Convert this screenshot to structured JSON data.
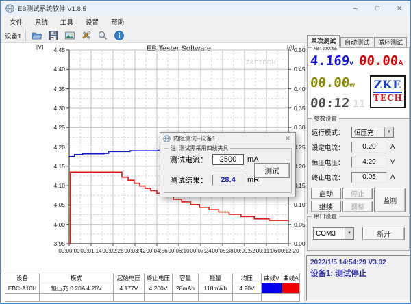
{
  "window": {
    "title": "EB测试系统软件 V1.8.5",
    "minimize": "─",
    "maximize": "□",
    "close": "✕"
  },
  "menu": {
    "items": [
      "文件",
      "系统",
      "工具",
      "设置",
      "帮助"
    ]
  },
  "toolbar": {
    "device_label": "设备1"
  },
  "chart_data": {
    "type": "line",
    "title": "EB Tester Software",
    "watermark": "ZKETECH",
    "y_left": {
      "label": "[V]",
      "range": [
        3.95,
        4.45
      ],
      "tick_labels": [
        "4.45",
        "4.40",
        "4.35",
        "4.30",
        "4.25",
        "4.20",
        "4.15",
        "4.10",
        "4.05",
        "4.00",
        "3.95"
      ]
    },
    "y_right": {
      "label": "[A]",
      "range": [
        0.0,
        0.5
      ],
      "tick_labels": [
        "0.50",
        "0.45",
        "0.40",
        "0.35",
        "0.30",
        "0.25",
        "0.20",
        "0.15",
        "0.10",
        "0.05",
        "0.00"
      ]
    },
    "x_axis": {
      "ticks_s": [
        0,
        74,
        148,
        222,
        296,
        370,
        444,
        518,
        592,
        666,
        740
      ],
      "tick_labels": [
        "00:00:00",
        "00:01:14",
        "00:02:28",
        "00:03:42",
        "00:04:56",
        "00:06:10",
        "00:07:24",
        "00:08:38",
        "00:09:52",
        "00:11:06",
        "00:12:20"
      ]
    },
    "series": [
      {
        "name": "voltage",
        "legend": "曲线V",
        "axis": "left",
        "color": "#1717cf",
        "step": true,
        "points": [
          [
            0,
            4.175
          ],
          [
            18,
            4.18
          ],
          [
            45,
            4.182
          ],
          [
            118,
            4.183
          ],
          [
            133,
            4.188
          ],
          [
            205,
            4.19
          ],
          [
            300,
            4.191
          ],
          [
            370,
            4.193
          ],
          [
            440,
            4.195
          ],
          [
            505,
            4.198
          ],
          [
            520,
            4.2
          ],
          [
            740,
            4.2
          ]
        ]
      },
      {
        "name": "current",
        "legend": "曲线A",
        "axis": "right",
        "color": "#e51717",
        "step": true,
        "points": [
          [
            0,
            0.0
          ],
          [
            4,
            0.185
          ],
          [
            173,
            0.185
          ],
          [
            178,
            0.172
          ],
          [
            199,
            0.164
          ],
          [
            219,
            0.156
          ],
          [
            238,
            0.149
          ],
          [
            256,
            0.143
          ],
          [
            275,
            0.137
          ],
          [
            296,
            0.13
          ],
          [
            324,
            0.122
          ],
          [
            352,
            0.115
          ],
          [
            380,
            0.108
          ],
          [
            410,
            0.101
          ],
          [
            440,
            0.094
          ],
          [
            472,
            0.088
          ],
          [
            505,
            0.082
          ],
          [
            540,
            0.076
          ],
          [
            580,
            0.07
          ],
          [
            625,
            0.064
          ],
          [
            675,
            0.06
          ],
          [
            740,
            0.057
          ]
        ]
      }
    ]
  },
  "table": {
    "headers": [
      "设备",
      "模式",
      "起始电压",
      "终止电压",
      "容量",
      "能量",
      "均压",
      "曲线V",
      "曲线A"
    ],
    "row": [
      "EBC-A10H",
      "恒压充  0.20A  4.20V",
      "4.177V",
      "4.200V",
      "28mAh",
      "118mWh",
      "4.20V"
    ],
    "curve_v_color": "#0000ee",
    "curve_a_color": "#f00000"
  },
  "right_panel": {
    "tabs": [
      "单次测试",
      "自动测试",
      "循环测试"
    ],
    "run_data": {
      "group_label": "运行数据",
      "voltage": "4.169",
      "voltage_unit": "v",
      "current": "00.00",
      "current_unit": "A",
      "power": "00.00",
      "power_unit": "w",
      "time": "00:12",
      "time_dim": "11",
      "logo_line1": "ZKE",
      "logo_line2": "TECH"
    },
    "params": {
      "group_label": "参数设置",
      "mode_label": "运行模式：",
      "mode_value": "恒压充",
      "set_current_label": "设定电流：",
      "set_current_value": "0.20",
      "set_current_unit": "A",
      "cv_label": "恒压电压：",
      "cv_value": "4.20",
      "cv_unit": "V",
      "end_current_label": "终止电流：",
      "end_current_value": "0.05",
      "end_current_unit": "A",
      "start": "启动",
      "stop": "停止",
      "monitor": "监测",
      "resume": "继续",
      "adjust": "调整"
    },
    "serial": {
      "group_label": "串口设置",
      "port": "COM3",
      "disconnect": "断开"
    },
    "status": {
      "line1": "2022/1/5 14:54:29  V3.02",
      "line2": "设备1: 测试停止"
    }
  },
  "dialog": {
    "title": "内阻测试--设备1",
    "close": "✕",
    "note": "注: 测试需采用四线夹具",
    "current_label": "测试电流：",
    "current_value": "2500",
    "current_unit": "mA",
    "result_label": "测试结果：",
    "result_value": "28.4",
    "result_unit": "mR",
    "test_button": "测试"
  }
}
